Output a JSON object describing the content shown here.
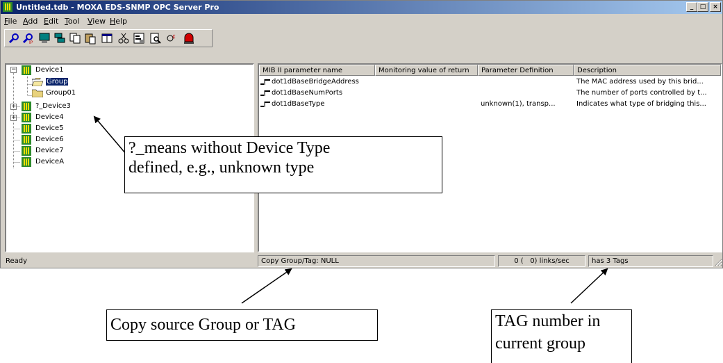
{
  "window": {
    "title": "Untitled.tdb - MOXA EDS-SNMP OPC Server Pro",
    "minimize": "_",
    "maximize": "□",
    "close": "×"
  },
  "menu": [
    {
      "label": "File",
      "key": "F",
      "rest": "ile"
    },
    {
      "label": "Add",
      "key": "A",
      "rest": "dd"
    },
    {
      "label": "Edit",
      "key": "E",
      "rest": "dit"
    },
    {
      "label": "Tool",
      "key": "T",
      "rest": "ool"
    },
    {
      "label": "View",
      "key": "V",
      "rest": "iew"
    },
    {
      "label": "Help",
      "key": "H",
      "rest": "elp"
    }
  ],
  "toolbar": {
    "icons": [
      "find-icon",
      "ip-find-icon",
      "computer-icon",
      "network-icon",
      "copy-icon",
      "paste-icon",
      "window-icon",
      "cut-icon",
      "properties-icon",
      "preview-icon",
      "quick-client-icon",
      "alarm-icon"
    ]
  },
  "tree": {
    "device1": "Device1",
    "group": "Group",
    "group01": "Group01",
    "device3": "?_Device3",
    "device4": "Device4",
    "device5": "Device5",
    "device6": "Device6",
    "device7": "Device7",
    "deviceA": "DeviceA"
  },
  "list": {
    "headers": [
      "MIB II parameter name",
      "Monitoring value of return",
      "Parameter Definition",
      "Description"
    ],
    "rows": [
      {
        "name": "dot1dBaseBridgeAddress",
        "value": "",
        "definition": "",
        "description": "The MAC address used by this brid..."
      },
      {
        "name": "dot1dBaseNumPorts",
        "value": "",
        "definition": "",
        "description": "The number of ports controlled by t..."
      },
      {
        "name": "dot1dBaseType",
        "value": "",
        "definition": "unknown(1), transp...",
        "description": "Indicates what type of bridging this..."
      }
    ]
  },
  "status": {
    "ready": "Ready",
    "copy": "Copy Group/Tag: NULL",
    "links": "0 (   0) links/sec",
    "tags": "has 3 Tags"
  },
  "callouts": {
    "device_type_line1": "?_means without Device Type",
    "device_type_line2": "defined, e.g., unknown type",
    "copy_source": "Copy source Group or TAG",
    "tag_number_line1": "TAG number in",
    "tag_number_line2": "current group"
  }
}
